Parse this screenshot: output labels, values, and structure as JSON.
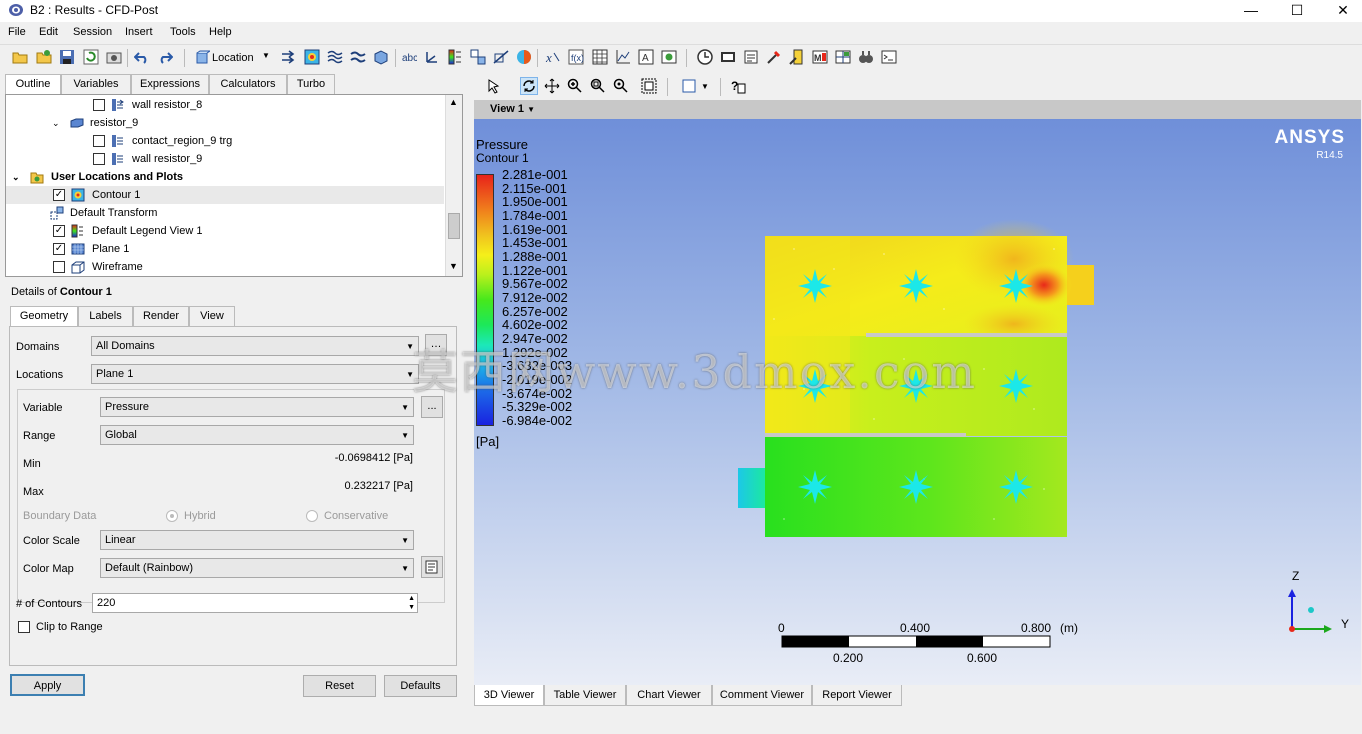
{
  "window": {
    "title": "B2 : Results - CFD-Post",
    "minimize": "—",
    "maximize": "☐",
    "close": "✕"
  },
  "menu": [
    "File",
    "Edit",
    "Session",
    "Insert",
    "Tools",
    "Help"
  ],
  "toolbar": {
    "location_label": "Location"
  },
  "outline": {
    "tabs": [
      "Outline",
      "Variables",
      "Expressions",
      "Calculators",
      "Turbo"
    ],
    "active_tab": "Outline",
    "tree": [
      {
        "label": "wall resistor_8",
        "checked": false,
        "icon": "wall-icon"
      },
      {
        "label": "resistor_9",
        "icon": "domain-icon",
        "expanded": true
      },
      {
        "label": "contact_region_9 trg",
        "checked": false,
        "icon": "wall-icon"
      },
      {
        "label": "wall resistor_9",
        "checked": false,
        "icon": "wall-icon"
      },
      {
        "label": "User Locations and Plots",
        "icon": "folder-icon",
        "expanded": true
      },
      {
        "label": "Contour 1",
        "checked": true,
        "icon": "contour-icon",
        "selected": true
      },
      {
        "label": "Default Transform",
        "icon": "transform-icon"
      },
      {
        "label": "Default Legend View 1",
        "checked": true,
        "icon": "legend-icon"
      },
      {
        "label": "Plane 1",
        "checked": true,
        "icon": "plane-icon"
      },
      {
        "label": "Wireframe",
        "checked": false,
        "icon": "wireframe-icon"
      }
    ]
  },
  "details": {
    "title_prefix": "Details of",
    "title_object": "Contour 1",
    "tabs": [
      "Geometry",
      "Labels",
      "Render",
      "View"
    ],
    "active_tab": "Geometry",
    "domains_label": "Domains",
    "domains_value": "All Domains",
    "locations_label": "Locations",
    "locations_value": "Plane 1",
    "variable_label": "Variable",
    "variable_value": "Pressure",
    "range_label": "Range",
    "range_value": "Global",
    "min_label": "Min",
    "min_value": "-0.0698412 [Pa]",
    "max_label": "Max",
    "max_value": "0.232217 [Pa]",
    "boundary_label": "Boundary Data",
    "boundary_hybrid": "Hybrid",
    "boundary_conservative": "Conservative",
    "colorscale_label": "Color Scale",
    "colorscale_value": "Linear",
    "colormap_label": "Color Map",
    "colormap_value": "Default (Rainbow)",
    "contours_label": "# of Contours",
    "contours_value": "220",
    "clip_label": "Clip to Range",
    "clip_checked": false,
    "ellipsis": "...",
    "apply": "Apply",
    "reset": "Reset",
    "defaults": "Defaults"
  },
  "viewer": {
    "view_title": "View 1",
    "brand": "ANSYS",
    "version": "R14.5",
    "legend_title": "Pressure",
    "legend_subtitle": "Contour 1",
    "legend_values": [
      "2.281e-001",
      "2.115e-001",
      "1.950e-001",
      "1.784e-001",
      "1.619e-001",
      "1.453e-001",
      "1.288e-001",
      "1.122e-001",
      "9.567e-002",
      "7.912e-002",
      "6.257e-002",
      "4.602e-002",
      "2.947e-002",
      "1.292e-002",
      "-3.632e-003",
      "-2.019e-002",
      "-3.674e-002",
      "-5.329e-002",
      "-6.984e-002"
    ],
    "legend_unit": "[Pa]",
    "scale_top": [
      "0",
      "0.400",
      "0.800"
    ],
    "scale_unit": "(m)",
    "scale_bottom": [
      "0.200",
      "0.600"
    ],
    "axis_z": "Z",
    "axis_y": "Y",
    "tabs": [
      "3D Viewer",
      "Table Viewer",
      "Chart Viewer",
      "Comment Viewer",
      "Report Viewer"
    ],
    "active_tab": "3D Viewer"
  },
  "watermark": "莫西网www.3dmox.com",
  "colors": {
    "accent": "#3c7fb1",
    "viewport_top": "#6f8fd9",
    "viewport_bottom": "#e9edf6"
  }
}
